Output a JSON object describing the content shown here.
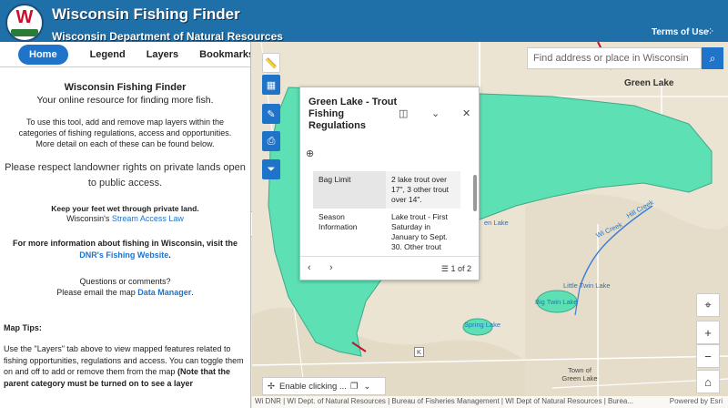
{
  "header": {
    "title": "Wisconsin Fishing Finder",
    "subtitle": "Wisconsin Department of Natural Resources",
    "terms": "Terms of Use"
  },
  "tabs": [
    {
      "label": "Home",
      "active": true
    },
    {
      "label": "Legend"
    },
    {
      "label": "Layers"
    },
    {
      "label": "Bookmarks"
    }
  ],
  "home": {
    "title": "Wisconsin Fishing Finder",
    "subtitle": "Your online resource for finding more fish.",
    "intro": "To use this tool, add and remove map layers within the categories of fishing regulations, access and opportunities. More detail on each of these can be found below.",
    "respect": "Please respect landowner rights on private lands open to public access.",
    "keep_dry": "Keep your feet wet through private land.",
    "stream_prefix": "Wisconsin's ",
    "stream_link": "Stream Access Law",
    "more_info": "For more information about fishing in Wisconsin, visit the",
    "dnr_link": "DNR's Fishing Website",
    "period": ".",
    "questions": "Questions or comments?",
    "email_prefix": "Please email the map ",
    "email_link": "Data Manager",
    "tips_heading": "Map Tips:",
    "tips_text": "Use the \"Layers\" tab above to view mapped features related to fishing opportunities, regulations and access. You can toggle them on and off to add or remove them from the map ",
    "tips_bold": "(Note that the parent category must be turned on to see a layer"
  },
  "search": {
    "placeholder": "Find address or place in Wisconsin"
  },
  "popup": {
    "title": "Green Lake - Trout Fishing Regulations",
    "rows": [
      {
        "field": "Bag Limit",
        "value": "2 lake trout over 17\", 3 other trout over 14\"."
      },
      {
        "field": "Season Information",
        "value": "Lake trout - First Saturday in January to Sept. 30. Other trout"
      }
    ],
    "pager": "1 of 2"
  },
  "map_labels": {
    "green_lake": "Green Lake",
    "hill_creek": "Hill Creek",
    "wi_creek": "Wi Creek",
    "big_twin": "Big Twin Lake",
    "little_twin": "Little Twin Lake",
    "spring_lake": "Spring Lake",
    "town": "Town of Green Lake",
    "lake_label": "en Lake",
    "k_marker": "K"
  },
  "enable_label": "Enable clicking ...",
  "attribution": "Wi DNR | WI Dept. of Natural Resources | Bureau of Fisheries Management | WI Dept of Natural Resources | Burea...",
  "powered": "Powered by Esri",
  "colors": {
    "header": "#1f6fa8",
    "accent": "#1f73c9",
    "lake": "#5de0b4",
    "land": "#ece6d6"
  }
}
